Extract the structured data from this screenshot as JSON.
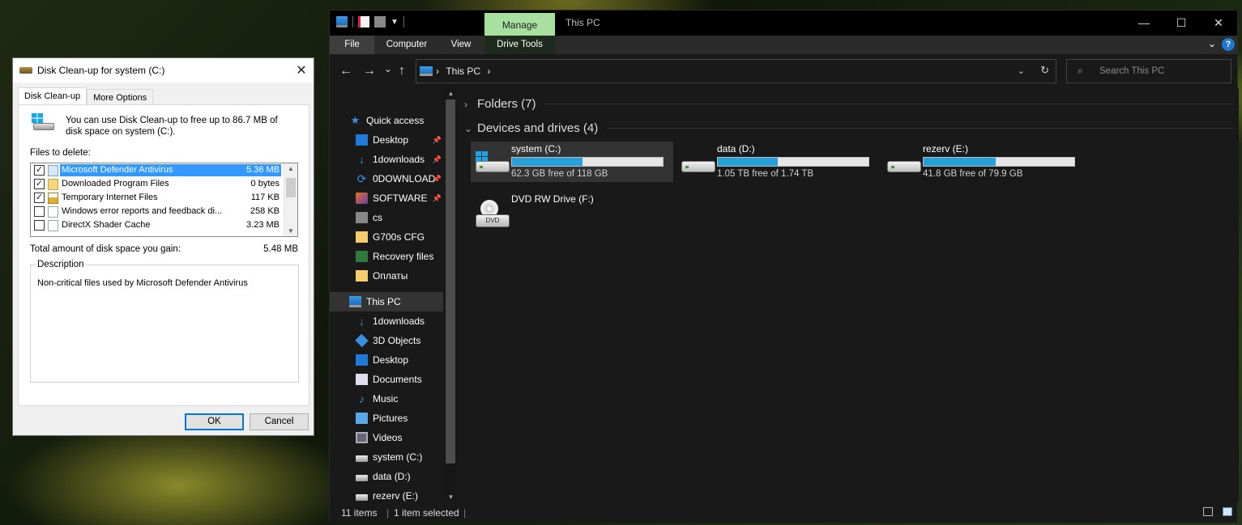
{
  "cleanup": {
    "title": "Disk Clean-up for system (C:)",
    "close": "✕",
    "tabs": [
      "Disk Clean-up",
      "More Options"
    ],
    "intro": "You can use Disk Clean-up to free up to 86.7 MB of disk space on system (C:).",
    "files_label": "Files to delete:",
    "files": [
      {
        "checked": true,
        "icon": "blue",
        "name": "Microsoft Defender Antivirus",
        "size": "5.36 MB",
        "selected": true
      },
      {
        "checked": true,
        "icon": "folder",
        "name": "Downloaded Program Files",
        "size": "0 bytes",
        "selected": false
      },
      {
        "checked": true,
        "icon": "lock",
        "name": "Temporary Internet Files",
        "size": "117 KB",
        "selected": false
      },
      {
        "checked": false,
        "icon": "doc",
        "name": "Windows error reports and feedback di...",
        "size": "258 KB",
        "selected": false
      },
      {
        "checked": false,
        "icon": "doc",
        "name": "DirectX Shader Cache",
        "size": "3.23 MB",
        "selected": false
      }
    ],
    "total_label": "Total amount of disk space you gain:",
    "total_value": "5.48 MB",
    "description_label": "Description",
    "description_text": "Non-critical files used by Microsoft Defender Antivirus",
    "ok": "OK",
    "cancel": "Cancel"
  },
  "explorer": {
    "manage_tab": "Manage",
    "window_title": "This PC",
    "controls": {
      "minimize": "—",
      "maximize": "☐",
      "close": "✕"
    },
    "ribbon_tabs": {
      "file": "File",
      "computer": "Computer",
      "view": "View",
      "drive_tools": "Drive Tools"
    },
    "help": "?",
    "nav_buttons": {
      "back": "←",
      "forward": "→",
      "recent": "⌄",
      "up": "↑"
    },
    "address": "This PC",
    "address_sep": "›",
    "search_placeholder": "Search This PC",
    "nav": [
      {
        "label": "Quick access",
        "icon": "star",
        "pinned": false,
        "indent": 0,
        "selected": false
      },
      {
        "label": "Desktop",
        "icon": "desk",
        "pinned": true,
        "indent": 1,
        "selected": false
      },
      {
        "label": "1downloads",
        "icon": "down",
        "pinned": true,
        "indent": 1,
        "selected": false
      },
      {
        "label": "0DOWNLOAD",
        "icon": "sync",
        "pinned": true,
        "indent": 1,
        "selected": false
      },
      {
        "label": "SOFTWARE",
        "icon": "soft",
        "pinned": true,
        "indent": 1,
        "selected": false
      },
      {
        "label": "cs",
        "icon": "cs",
        "pinned": false,
        "indent": 1,
        "selected": false
      },
      {
        "label": "G700s CFG",
        "icon": "fold",
        "pinned": false,
        "indent": 1,
        "selected": false
      },
      {
        "label": "Recovery files",
        "icon": "rec",
        "pinned": false,
        "indent": 1,
        "selected": false
      },
      {
        "label": "Оплаты",
        "icon": "fold",
        "pinned": false,
        "indent": 1,
        "selected": false
      },
      {
        "label": "This PC",
        "icon": "pc",
        "pinned": false,
        "indent": 0,
        "selected": true
      },
      {
        "label": "1downloads",
        "icon": "down",
        "pinned": false,
        "indent": 1,
        "selected": false
      },
      {
        "label": "3D Objects",
        "icon": "3d",
        "pinned": false,
        "indent": 1,
        "selected": false
      },
      {
        "label": "Desktop",
        "icon": "desk",
        "pinned": false,
        "indent": 1,
        "selected": false
      },
      {
        "label": "Documents",
        "icon": "docs",
        "pinned": false,
        "indent": 1,
        "selected": false
      },
      {
        "label": "Music",
        "icon": "music",
        "pinned": false,
        "indent": 1,
        "selected": false
      },
      {
        "label": "Pictures",
        "icon": "pic",
        "pinned": false,
        "indent": 1,
        "selected": false
      },
      {
        "label": "Videos",
        "icon": "vid",
        "pinned": false,
        "indent": 1,
        "selected": false
      },
      {
        "label": "system (C:)",
        "icon": "drv",
        "pinned": false,
        "indent": 1,
        "selected": false
      },
      {
        "label": "data (D:)",
        "icon": "drv",
        "pinned": false,
        "indent": 1,
        "selected": false
      },
      {
        "label": "rezerv (E:)",
        "icon": "drv",
        "pinned": false,
        "indent": 1,
        "selected": false
      }
    ],
    "groups": {
      "folders": "Folders (7)",
      "devices": "Devices and drives (4)"
    },
    "drives": [
      {
        "name": "system (C:)",
        "free": "62.3 GB free of 118 GB",
        "used_fraction": 0.47,
        "windows": true,
        "selected": true
      },
      {
        "name": "data (D:)",
        "free": "1.05 TB free of 1.74 TB",
        "used_fraction": 0.4,
        "windows": false,
        "selected": false
      },
      {
        "name": "rezerv (E:)",
        "free": "41.8 GB free of 79.9 GB",
        "used_fraction": 0.48,
        "windows": false,
        "selected": false
      }
    ],
    "dvd": {
      "name": "DVD RW Drive (F:)",
      "label": "DVD"
    },
    "status": {
      "items": "11 items",
      "selected": "1 item selected",
      "sep": "|"
    },
    "colors": {
      "manage_tab": "#a8e0a0",
      "bar_fill": "#26a0da",
      "accent": "#0078d7"
    }
  }
}
